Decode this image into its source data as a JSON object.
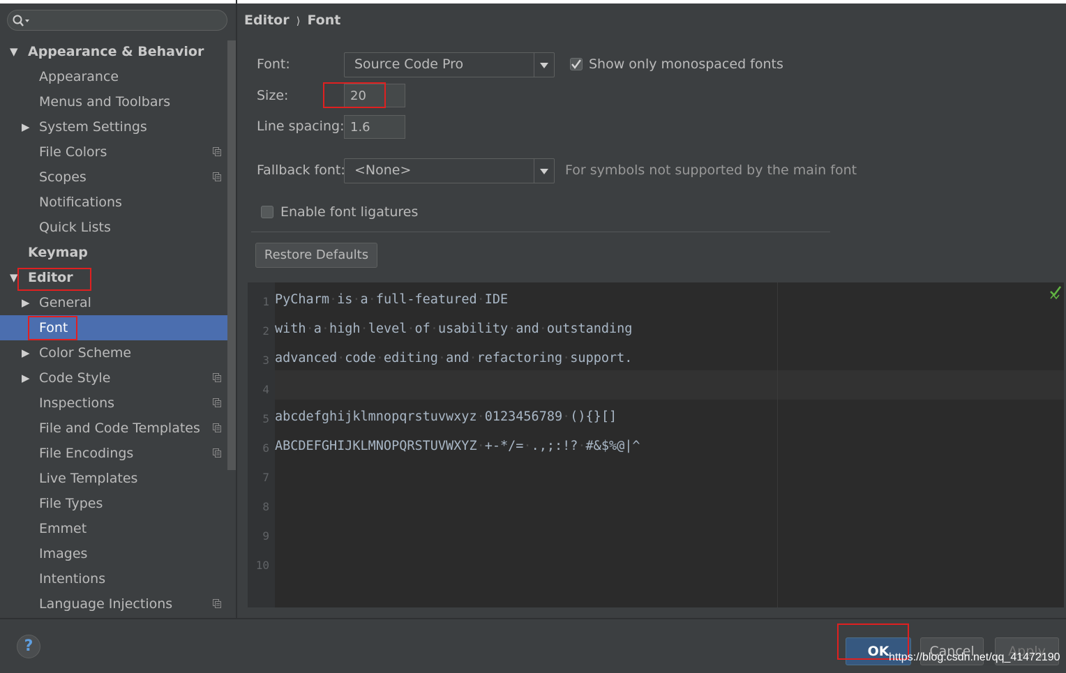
{
  "search": {
    "placeholder": ""
  },
  "sidebar": {
    "items": [
      {
        "label": "Appearance & Behavior",
        "level": 0,
        "arrow": "expanded",
        "bold": true,
        "project": false
      },
      {
        "label": "Appearance",
        "level": 1,
        "arrow": "none",
        "bold": false,
        "project": false
      },
      {
        "label": "Menus and Toolbars",
        "level": 1,
        "arrow": "none",
        "bold": false,
        "project": false
      },
      {
        "label": "System Settings",
        "level": 1,
        "arrow": "collapsed",
        "bold": false,
        "project": false
      },
      {
        "label": "File Colors",
        "level": 1,
        "arrow": "none",
        "bold": false,
        "project": true
      },
      {
        "label": "Scopes",
        "level": 1,
        "arrow": "none",
        "bold": false,
        "project": true
      },
      {
        "label": "Notifications",
        "level": 1,
        "arrow": "none",
        "bold": false,
        "project": false
      },
      {
        "label": "Quick Lists",
        "level": 1,
        "arrow": "none",
        "bold": false,
        "project": false
      },
      {
        "label": "Keymap",
        "level": 0,
        "arrow": "none",
        "bold": true,
        "project": false
      },
      {
        "label": "Editor",
        "level": 0,
        "arrow": "expanded",
        "bold": true,
        "project": false
      },
      {
        "label": "General",
        "level": 1,
        "arrow": "collapsed",
        "bold": false,
        "project": false
      },
      {
        "label": "Font",
        "level": 1,
        "arrow": "none",
        "bold": false,
        "project": false,
        "selected": true
      },
      {
        "label": "Color Scheme",
        "level": 1,
        "arrow": "collapsed",
        "bold": false,
        "project": false
      },
      {
        "label": "Code Style",
        "level": 1,
        "arrow": "collapsed",
        "bold": false,
        "project": true
      },
      {
        "label": "Inspections",
        "level": 1,
        "arrow": "none",
        "bold": false,
        "project": true
      },
      {
        "label": "File and Code Templates",
        "level": 1,
        "arrow": "none",
        "bold": false,
        "project": true
      },
      {
        "label": "File Encodings",
        "level": 1,
        "arrow": "none",
        "bold": false,
        "project": true
      },
      {
        "label": "Live Templates",
        "level": 1,
        "arrow": "none",
        "bold": false,
        "project": false
      },
      {
        "label": "File Types",
        "level": 1,
        "arrow": "none",
        "bold": false,
        "project": false
      },
      {
        "label": "Emmet",
        "level": 1,
        "arrow": "none",
        "bold": false,
        "project": false
      },
      {
        "label": "Images",
        "level": 1,
        "arrow": "none",
        "bold": false,
        "project": false
      },
      {
        "label": "Intentions",
        "level": 1,
        "arrow": "none",
        "bold": false,
        "project": false
      },
      {
        "label": "Language Injections",
        "level": 1,
        "arrow": "none",
        "bold": false,
        "project": true
      }
    ]
  },
  "breadcrumb": {
    "parent": "Editor",
    "separator": "⟩",
    "current": "Font"
  },
  "font": {
    "label": "Font:",
    "value": "Source Code Pro",
    "mono_label": "Show only monospaced fonts",
    "mono_checked": true
  },
  "size": {
    "label": "Size:",
    "value": "20"
  },
  "line_spacing": {
    "label": "Line spacing:",
    "value": "1.6"
  },
  "fallback": {
    "label": "Fallback font:",
    "value": "<None>",
    "hint": "For symbols not supported by the main font"
  },
  "ligatures": {
    "label": "Enable font ligatures",
    "checked": false
  },
  "restore_label": "Restore Defaults",
  "preview": {
    "lines": [
      {
        "num": "1",
        "text": "PyCharm·is·a·full-featured·IDE"
      },
      {
        "num": "2",
        "text": "with·a·high·level·of·usability·and·outstanding"
      },
      {
        "num": "3",
        "text": "advanced·code·editing·and·refactoring·support."
      },
      {
        "num": "4",
        "text": ""
      },
      {
        "num": "5",
        "text": "abcdefghijklmnopqrstuvwxyz·0123456789·(){}[]"
      },
      {
        "num": "6",
        "text": "ABCDEFGHIJKLMNOPQRSTUVWXYZ·+-*/=·.,;:!?·#&$%@|^"
      },
      {
        "num": "7",
        "text": ""
      },
      {
        "num": "8",
        "text": ""
      },
      {
        "num": "9",
        "text": ""
      },
      {
        "num": "10",
        "text": ""
      }
    ]
  },
  "dialog": {
    "ok": "OK",
    "cancel": "Cancel",
    "apply": "Apply",
    "help": "?"
  },
  "watermark": "https://blog.csdn.net/qq_41472190",
  "colors": {
    "background": "#3c3f41",
    "selection": "#4b6eaf",
    "editor_background": "#2b2b2b",
    "highlight_box": "#e02020",
    "ok_button": "#365880"
  }
}
